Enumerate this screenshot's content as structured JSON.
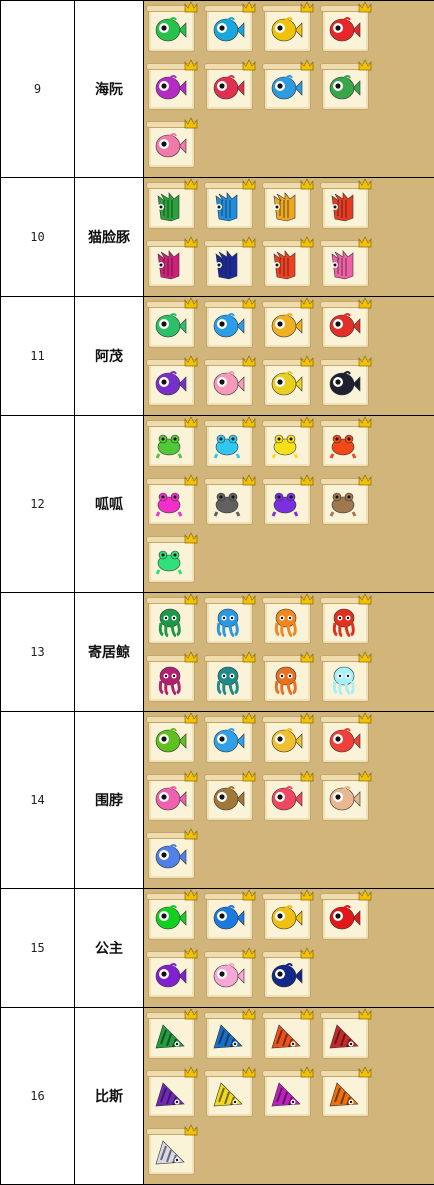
{
  "rows": [
    {
      "num": "9",
      "name": "海阮",
      "type": "round",
      "items": [
        "#27c24a",
        "#1aa6dc",
        "#f0c20a",
        "#e5272a",
        "#b42cc4",
        "#e03050",
        "#2c9be0",
        "#3aa64a",
        "#f07aa8"
      ]
    },
    {
      "num": "10",
      "name": "猫脸豚",
      "type": "spike",
      "items": [
        "#28a23a",
        "#1e8ee0",
        "#f0a820",
        "#e83a20",
        "#d0207a",
        "#1a2a9a",
        "#f04020",
        "#f060a8"
      ]
    },
    {
      "num": "11",
      "name": "阿茂",
      "type": "round",
      "items": [
        "#2cc068",
        "#2a9ee8",
        "#f0b020",
        "#e03028",
        "#7a30c8",
        "#f59ab8",
        "#e8d020",
        "#202030"
      ]
    },
    {
      "num": "12",
      "name": "呱呱",
      "type": "frog",
      "items": [
        "#50c838",
        "#30c8f0",
        "#f8e018",
        "#f04818",
        "#f030c8",
        "#606060",
        "#7a30e0",
        "#a07850",
        "#30e078"
      ]
    },
    {
      "num": "13",
      "name": "寄居鲸",
      "type": "octo",
      "items": [
        "#1a9a48",
        "#2a98e0",
        "#f08820",
        "#e03020",
        "#b02070",
        "#208a8a",
        "#e87020",
        "#a8f0f8"
      ]
    },
    {
      "num": "14",
      "name": "围脖",
      "type": "round",
      "items": [
        "#60c020",
        "#30a0e8",
        "#f0c030",
        "#f04038",
        "#f060b0",
        "#a07838",
        "#f04860",
        "#e8b890",
        "#5080e8"
      ]
    },
    {
      "num": "15",
      "name": "公主",
      "type": "round",
      "items": [
        "#10d020",
        "#1a7ae0",
        "#f0c010",
        "#e01818",
        "#8020d0",
        "#f5a8d8",
        "#102888"
      ]
    },
    {
      "num": "16",
      "name": "比斯",
      "type": "shell",
      "items": [
        "#20a040",
        "#1870c8",
        "#f05018",
        "#c82828",
        "#7028b8",
        "#f0d820",
        "#c020c0",
        "#f07010",
        "#d8d8e8"
      ]
    }
  ],
  "colors": {
    "panel_bg": "#d2b57b",
    "scroll": "#fbf3d8",
    "crown": "#f2c200"
  },
  "icon_names": {
    "card": "fish-card-icon",
    "crown": "crown-icon"
  }
}
